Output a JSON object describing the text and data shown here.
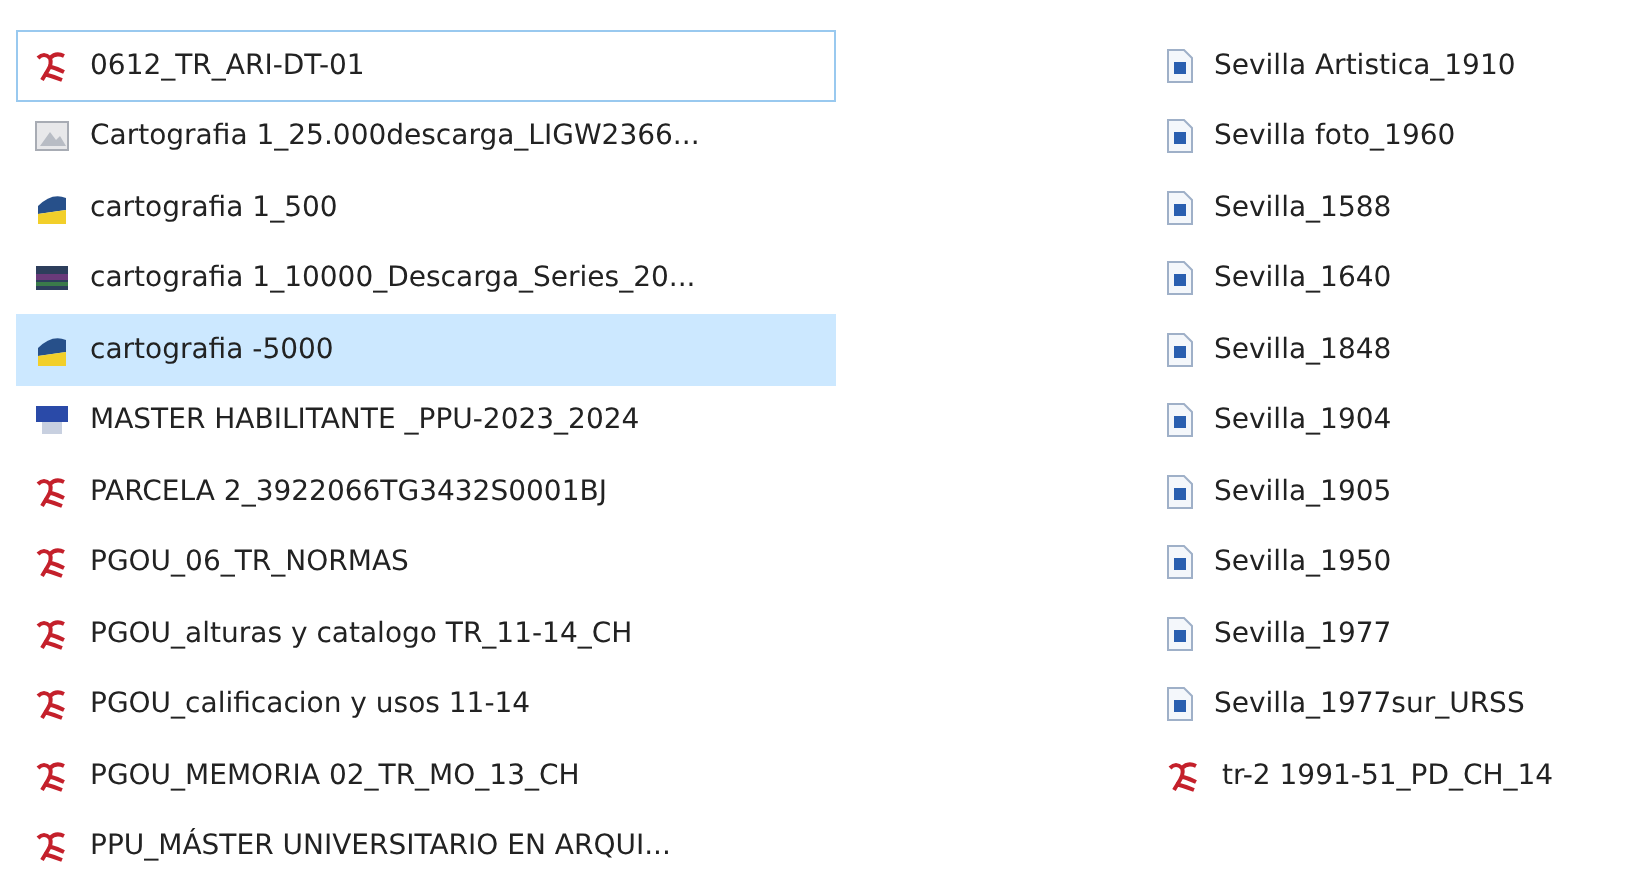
{
  "columns": [
    {
      "items": [
        {
          "name": "0612_TR_ARI-DT-01",
          "kind": "pdf",
          "selected": false,
          "focused": true
        },
        {
          "name": "Cartografia 1_25.000descarga_LIGW2366...",
          "kind": "image",
          "selected": false,
          "focused": false
        },
        {
          "name": "cartografia 1_500",
          "kind": "map",
          "selected": false,
          "focused": false
        },
        {
          "name": "cartografia 1_10000_Descarga_Series_20...",
          "kind": "archive",
          "selected": false,
          "focused": false
        },
        {
          "name": "cartografia -5000",
          "kind": "map",
          "selected": true,
          "focused": false
        },
        {
          "name": "MASTER HABILITANTE _PPU-2023_2024",
          "kind": "installer",
          "selected": false,
          "focused": false
        },
        {
          "name": "PARCELA 2_3922066TG3432S0001BJ",
          "kind": "pdf",
          "selected": false,
          "focused": false
        },
        {
          "name": "PGOU_06_TR_NORMAS",
          "kind": "pdf",
          "selected": false,
          "focused": false
        },
        {
          "name": "PGOU_alturas y catalogo TR_11-14_CH",
          "kind": "pdf",
          "selected": false,
          "focused": false
        },
        {
          "name": "PGOU_calificacion y usos 11-14",
          "kind": "pdf",
          "selected": false,
          "focused": false
        },
        {
          "name": "PGOU_MEMORIA 02_TR_MO_13_CH",
          "kind": "pdf",
          "selected": false,
          "focused": false
        },
        {
          "name": "PPU_MÁSTER UNIVERSITARIO EN ARQUI...",
          "kind": "pdf",
          "selected": false,
          "focused": false
        }
      ]
    },
    {
      "items": [
        {
          "name": "Sevilla Artistica_1910",
          "kind": "doc",
          "selected": false,
          "focused": false
        },
        {
          "name": "Sevilla foto_1960",
          "kind": "doc",
          "selected": false,
          "focused": false
        },
        {
          "name": "Sevilla_1588",
          "kind": "doc",
          "selected": false,
          "focused": false
        },
        {
          "name": "Sevilla_1640",
          "kind": "doc",
          "selected": false,
          "focused": false
        },
        {
          "name": "Sevilla_1848",
          "kind": "doc",
          "selected": false,
          "focused": false
        },
        {
          "name": "Sevilla_1904",
          "kind": "doc",
          "selected": false,
          "focused": false
        },
        {
          "name": "Sevilla_1905",
          "kind": "doc",
          "selected": false,
          "focused": false
        },
        {
          "name": "Sevilla_1950",
          "kind": "doc",
          "selected": false,
          "focused": false
        },
        {
          "name": "Sevilla_1977",
          "kind": "doc",
          "selected": false,
          "focused": false
        },
        {
          "name": "Sevilla_1977sur_URSS",
          "kind": "doc",
          "selected": false,
          "focused": false
        },
        {
          "name": "tr-2 1991-51_PD_CH_14",
          "kind": "pdf",
          "selected": false,
          "focused": false
        }
      ]
    }
  ]
}
